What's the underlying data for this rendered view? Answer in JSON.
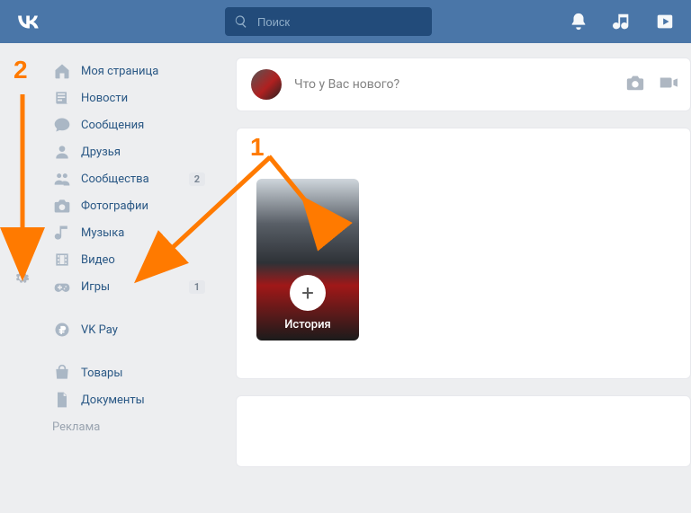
{
  "header": {
    "search_placeholder": "Поиск"
  },
  "sidebar": {
    "items": [
      {
        "label": "Моя страница"
      },
      {
        "label": "Новости"
      },
      {
        "label": "Сообщения"
      },
      {
        "label": "Друзья"
      },
      {
        "label": "Сообщества",
        "badge": "2"
      },
      {
        "label": "Фотографии"
      },
      {
        "label": "Музыка"
      },
      {
        "label": "Видео"
      },
      {
        "label": "Игры",
        "badge": "1"
      },
      {
        "label": "VK Pay"
      },
      {
        "label": "Товары"
      },
      {
        "label": "Документы"
      }
    ],
    "ads_label": "Реклама"
  },
  "compose": {
    "placeholder": "Что у Вас нового?"
  },
  "story": {
    "label": "История"
  },
  "annotations": {
    "num1": "1",
    "num2": "2"
  }
}
